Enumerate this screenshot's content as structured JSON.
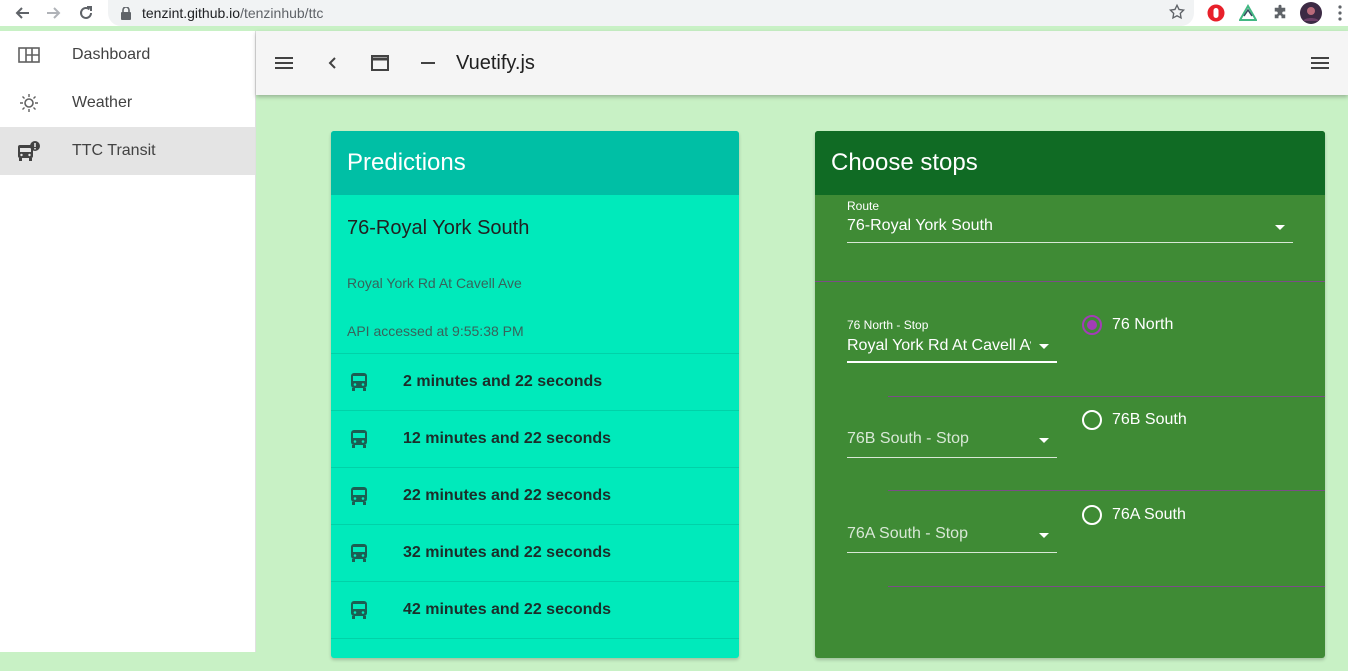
{
  "browser": {
    "url_host": "tenzint.github.io",
    "url_path": "/tenzinhub/ttc"
  },
  "sidebar": {
    "items": [
      {
        "label": "Dashboard",
        "icon": "dashboard-icon"
      },
      {
        "label": "Weather",
        "icon": "weather-icon"
      },
      {
        "label": "TTC Transit",
        "icon": "bus-alert-icon",
        "active": true
      }
    ]
  },
  "toolbar": {
    "title": "Vuetify.js"
  },
  "predictions": {
    "title": "Predictions",
    "route": "76-Royal York South",
    "stop": "Royal York Rd At Cavell Ave",
    "api_accessed": "API accessed at 9:55:38 PM",
    "times": [
      "2 minutes and 22 seconds",
      "12 minutes and 22 seconds",
      "22 minutes and 22 seconds",
      "32 minutes and 22 seconds",
      "42 minutes and 22 seconds"
    ]
  },
  "choose_stops": {
    "title": "Choose stops",
    "route_label": "Route",
    "route_value": "76-Royal York South",
    "stops": [
      {
        "label": "76 North - Stop",
        "value": "Royal York Rd At Cavell Av",
        "radio": "76 North",
        "selected": true
      },
      {
        "label": "",
        "placeholder": "76B South - Stop",
        "radio": "76B South",
        "selected": false
      },
      {
        "label": "",
        "placeholder": "76A South - Stop",
        "radio": "76A South",
        "selected": false
      }
    ]
  },
  "colors": {
    "page_bg": "#c8f1c5",
    "predictions_bg": "#00eabb",
    "predictions_header": "#00bfa5",
    "stops_bg": "#3f8b35",
    "stops_header": "#106b24",
    "radio_accent": "#a23db6"
  }
}
